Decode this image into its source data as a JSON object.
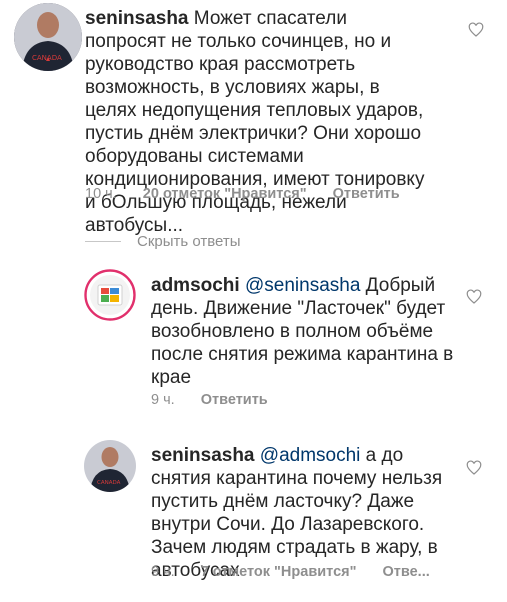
{
  "comments": [
    {
      "username": "seninsasha",
      "mention": "",
      "text": "Может спасатели попросят не только сочинцев, но и руководство края рассмотреть возможность, в условиях жары, в целях недопущения тепловых ударов, пустиь днём электрички? Они хорошо оборудованы системами кондиционирования, имеют тонировку и бОльшую площадь, нежели автобусы...",
      "time": "10 ч.",
      "likes": "20 отметок \"Нравится\"",
      "reply": "Ответить"
    },
    {
      "username": "admsochi",
      "mention": "@seninsasha",
      "text": " Добрый день. Движение \"Ласточек\" будет возобновлено в полном объёме после снятия режима карантина в крае",
      "time": "9 ч.",
      "likes": "",
      "reply": "Ответить"
    },
    {
      "username": "seninsasha",
      "mention": "@admsochi",
      "text": " а до снятия карантина почему нельзя пустить днём ласточку? Даже внутри Сочи. До Лазаревского.  Зачем людям страдать в жару, в автобусах",
      "time": "9 ч.",
      "likes": "7 отметок \"Нравится\"",
      "reply": "Отве..."
    }
  ],
  "hide_replies_label": "Скрыть ответы",
  "colors": {
    "text": "#262626",
    "meta": "#8e8e8e",
    "mention": "#00376b",
    "avatar_border": "#e1306c"
  }
}
